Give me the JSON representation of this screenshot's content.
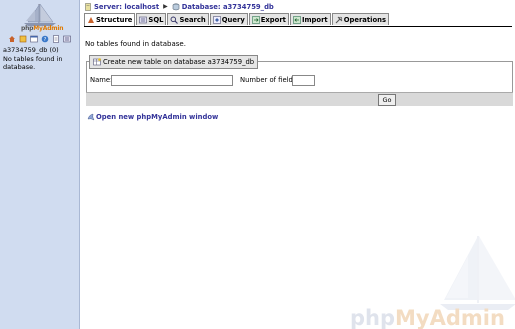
{
  "nav": {
    "logo_pre": "php",
    "logo_post": "MyAdmin",
    "icons": [
      "home-icon",
      "exit-icon",
      "query-window-icon",
      "help-icon",
      "docs-icon",
      "sql-icon"
    ],
    "db_name": "a3734759_db (0)",
    "no_tables": "No tables found in database."
  },
  "breadcrumb": {
    "server": "Server: localhost",
    "database": "Database: a3734759_db"
  },
  "tabs": [
    {
      "label": "Structure",
      "icon": "structure-icon",
      "active": true
    },
    {
      "label": "SQL",
      "icon": "sql-icon"
    },
    {
      "label": "Search",
      "icon": "search-icon"
    },
    {
      "label": "Query",
      "icon": "query-icon"
    },
    {
      "label": "Export",
      "icon": "export-icon"
    },
    {
      "label": "Import",
      "icon": "import-icon"
    },
    {
      "label": "Operations",
      "icon": "operations-icon"
    }
  ],
  "content": {
    "no_tables": "No tables found in database.",
    "create_legend": "Create new table on database a3734759_db",
    "name_label": "Name:",
    "name_value": "",
    "fields_label": "Number of fields:",
    "fields_value": "",
    "go_label": "Go",
    "new_window": "Open new phpMyAdmin window"
  },
  "watermark": {
    "pre": "php",
    "post": "MyAdmin"
  },
  "colors": {
    "nav_bg": "#d0dcf0",
    "link": "#333399",
    "logo_orange": "#e07a00"
  }
}
